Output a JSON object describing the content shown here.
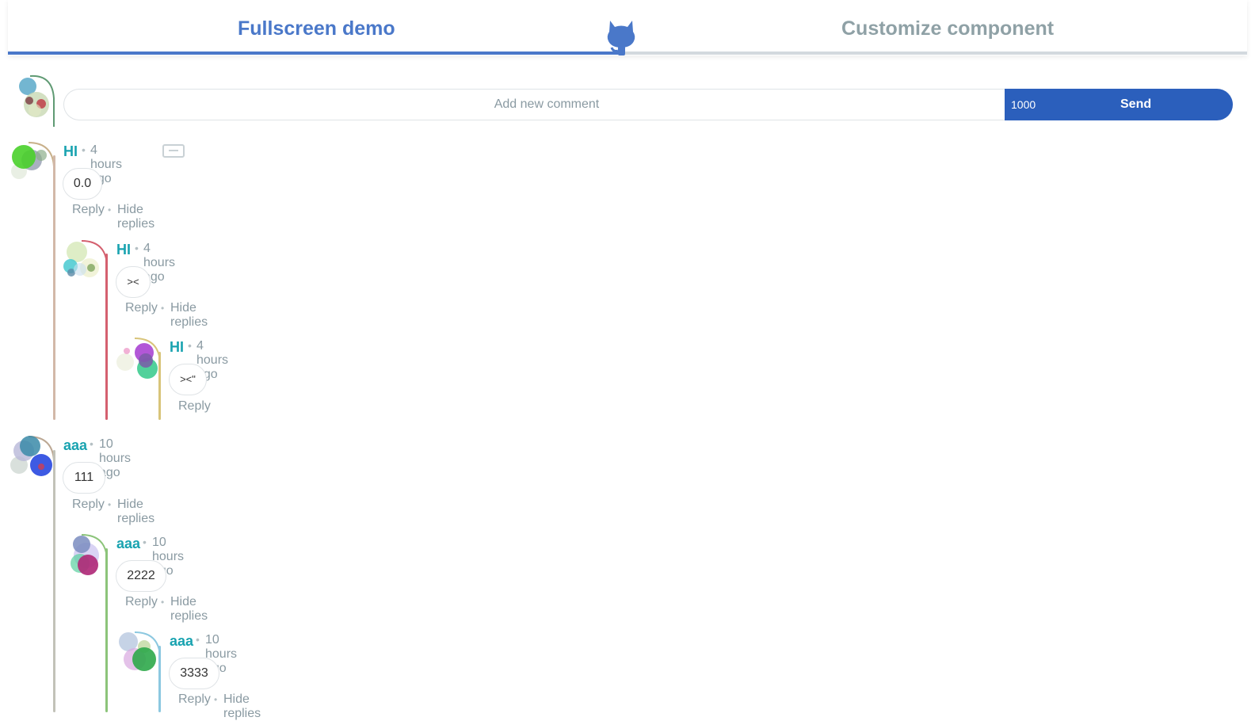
{
  "header": {
    "tab_left": "Fullscreen demo",
    "tab_right": "Customize component",
    "accent": "#4a78c9",
    "icon": "github-octocat-icon"
  },
  "composer": {
    "placeholder": "Add new comment",
    "char_count": "1000",
    "send_label": "Send",
    "send_color": "#2b5fbc"
  },
  "comments": [
    {
      "name": "HI",
      "time": "4 hours ago",
      "text": "0.0",
      "reply": "Reply",
      "hide": "Hide replies"
    },
    {
      "name": "HI",
      "time": "4 hours ago",
      "text": "><",
      "reply": "Reply",
      "hide": "Hide replies"
    },
    {
      "name": "HI",
      "time": "4 hours ago",
      "text": "><\"",
      "reply": "Reply"
    },
    {
      "name": "aaa",
      "time": "10 hours ago",
      "text": "111",
      "reply": "Reply",
      "hide": "Hide replies"
    },
    {
      "name": "aaa",
      "time": "10 hours ago",
      "text": "2222",
      "reply": "Reply",
      "hide": "Hide replies"
    },
    {
      "name": "aaa",
      "time": "10 hours ago",
      "text": "3333",
      "reply": "Reply",
      "hide": "Hide replies"
    }
  ],
  "colors": {
    "name": "#19a3b0",
    "muted": "#8a9aa2"
  }
}
